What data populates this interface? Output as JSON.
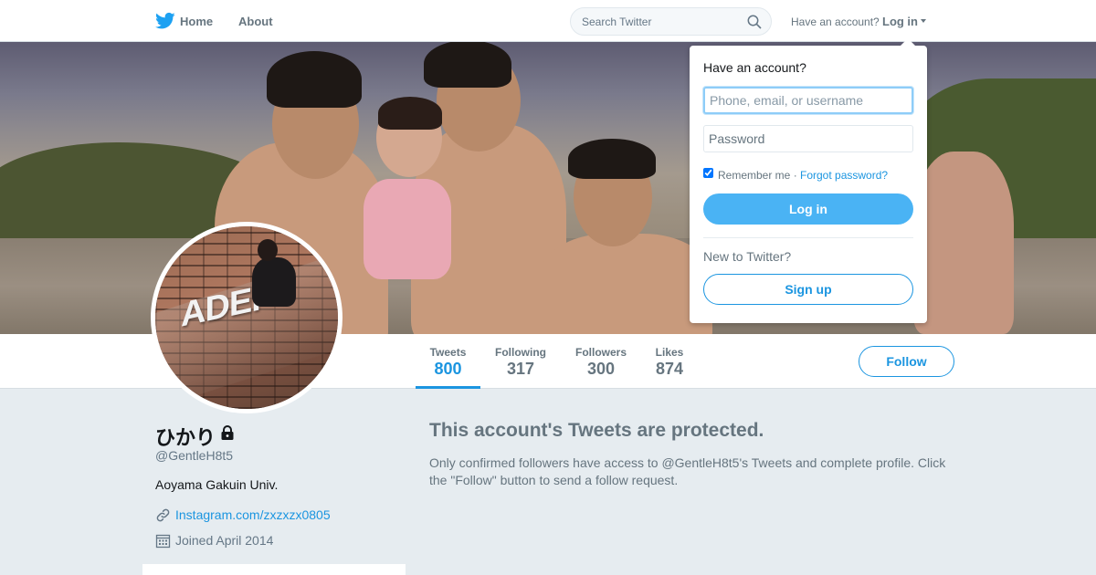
{
  "nav": {
    "home_label": "Home",
    "about_label": "About",
    "search_placeholder": "Search Twitter",
    "have_account_text": "Have an account?",
    "login_label": "Log in"
  },
  "login_dropdown": {
    "title": "Have an account?",
    "username_placeholder": "Phone, email, or username",
    "password_placeholder": "Password",
    "remember_label": "Remember me ·",
    "remember_checked": true,
    "forgot_label": "Forgot password?",
    "login_button": "Log in",
    "new_prompt": "New to Twitter?",
    "signup_button": "Sign up"
  },
  "stats": [
    {
      "label": "Tweets",
      "value": "800",
      "active": true
    },
    {
      "label": "Following",
      "value": "317",
      "active": false
    },
    {
      "label": "Followers",
      "value": "300",
      "active": false
    },
    {
      "label": "Likes",
      "value": "874",
      "active": false
    }
  ],
  "follow_button": "Follow",
  "profile": {
    "name": "ひかり",
    "protected": true,
    "handle": "@GentleH8t5",
    "bio": "Aoyama Gakuin Univ.",
    "link": "Instagram.com/zxzxzx0805",
    "joined": "Joined April 2014",
    "avatar_sign_text": "ADEP"
  },
  "protected_notice": {
    "title": "This account's Tweets are protected.",
    "body": "Only confirmed followers have access to @GentleH8t5's Tweets and complete profile. Click the \"Follow\" button to send a follow request."
  },
  "colors": {
    "accent": "#1b95e0",
    "button_fill": "#4ab3f4",
    "page_background": "#e6ecf0",
    "muted_text": "#66757f"
  },
  "icons": [
    "twitter-bird-icon",
    "search-icon",
    "chevron-down-icon",
    "lock-icon",
    "link-icon",
    "calendar-icon"
  ]
}
